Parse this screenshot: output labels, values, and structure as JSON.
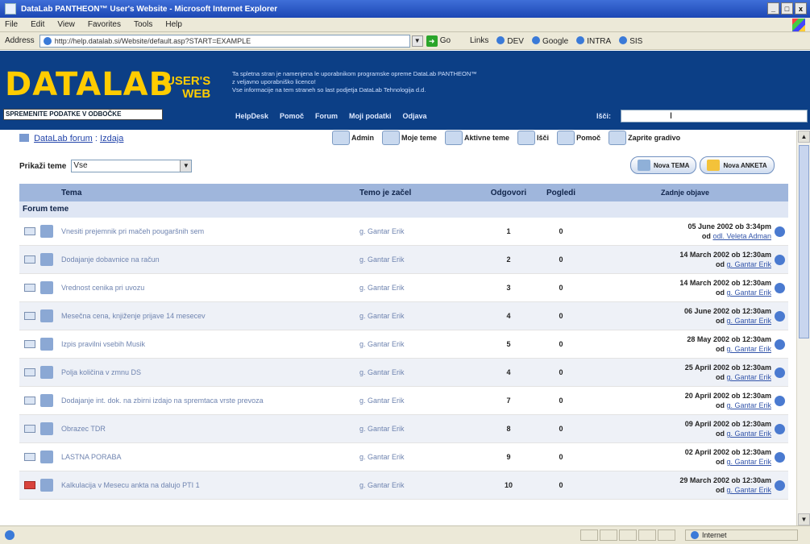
{
  "window": {
    "title": "DataLab PANTHEON™ User's Website - Microsoft Internet Explorer",
    "min": "_",
    "max": "□",
    "close": "x"
  },
  "menu": [
    "File",
    "Edit",
    "View",
    "Favorites",
    "Tools",
    "Help"
  ],
  "address": {
    "label": "Address",
    "url": "http://help.datalab.si/Website/default.asp?START=EXAMPLE",
    "go": "Go",
    "links_label": "Links",
    "links": [
      "DEV",
      "Google",
      "INTRA",
      "SIS"
    ]
  },
  "site": {
    "logo": "DATALAB",
    "user": "USER'S",
    "web": "WEB",
    "slogan": "SPREMENITE PODATKE V ODBOČKE",
    "notice": [
      "Ta spletna stran je namenjena le uporabnikom programske opreme DataLab PANTHEON™",
      "z veljavno uporabniško licenco!",
      "Vse informacije na tem straneh so last podjetja DataLab Tehnologija d.d."
    ],
    "nav": [
      "HelpDesk",
      "Pomoč",
      "Forum",
      "Moji podatki",
      "Odjava"
    ],
    "search_label": "Išči:"
  },
  "forum": {
    "breadcrumb_root": "DataLab forum",
    "breadcrumb_sep": ":",
    "breadcrumb_current": "Izdaja",
    "toolbar": [
      "Admin",
      "Moje teme",
      "Aktivne teme",
      "Išči",
      "Pomoč",
      "Zaprite gradivo"
    ],
    "filter_label": "Prikaži teme",
    "filter_value": "Vse",
    "new_topic": "Nova TEMA",
    "new_poll": "Nova ANKETA",
    "columns": {
      "topic": "Tema",
      "author": "Temo je začel",
      "replies": "Odgovori",
      "views": "Pogledi",
      "last": "Zadnje objave"
    },
    "section": "Forum teme",
    "rows": [
      {
        "topic": "Vnesiti prejemnik pri mačeh pougaršnih sem",
        "author": "g. Gantar Erik",
        "replies": "1",
        "views": "0",
        "date": "05 June 2002 ob 3:34pm",
        "by_prefix": "od",
        "by": "odl. Veleta Adman"
      },
      {
        "topic": "Dodajanje dobavnice na račun",
        "author": "g. Gantar Erik",
        "replies": "2",
        "views": "0",
        "date": "14 March 2002 ob 12:30am",
        "by_prefix": "od",
        "by": "g. Gantar Erik"
      },
      {
        "topic": "Vrednost cenika pri uvozu",
        "author": "g. Gantar Erik",
        "replies": "3",
        "views": "0",
        "date": "14 March 2002 ob 12:30am",
        "by_prefix": "od",
        "by": "g. Gantar Erik"
      },
      {
        "topic": "Mesečna cena, knjiženje prijave 14 mesecev",
        "author": "g. Gantar Erik",
        "replies": "4",
        "views": "0",
        "date": "06 June 2002 ob 12:30am",
        "by_prefix": "od",
        "by": "g. Gantar Erik"
      },
      {
        "topic": "Izpis pravilni vsebih Musik",
        "author": "g. Gantar Erik",
        "replies": "5",
        "views": "0",
        "date": "28 May 2002 ob 12:30am",
        "by_prefix": "od",
        "by": "g. Gantar Erik"
      },
      {
        "topic": "Polja količina v zmnu DS",
        "author": "g. Gantar Erik",
        "replies": "4",
        "views": "0",
        "date": "25 April 2002 ob 12:30am",
        "by_prefix": "od",
        "by": "g. Gantar Erik"
      },
      {
        "topic": "Dodajanje int. dok. na zbirni izdajo na spremtaca vrste prevoza",
        "author": "g. Gantar Erik",
        "replies": "7",
        "views": "0",
        "date": "20 April 2002 ob 12:30am",
        "by_prefix": "od",
        "by": "g. Gantar Erik"
      },
      {
        "topic": "Obrazec TDR",
        "author": "g. Gantar Erik",
        "replies": "8",
        "views": "0",
        "date": "09 April 2002 ob 12:30am",
        "by_prefix": "od",
        "by": "g. Gantar Erik"
      },
      {
        "topic": "LASTNA PORABA",
        "author": "g. Gantar Erik",
        "replies": "9",
        "views": "0",
        "date": "02 April 2002 ob 12:30am",
        "by_prefix": "od",
        "by": "g. Gantar Erik"
      },
      {
        "topic": "Kalkulacija v Mesecu ankta na dalujo PTI 1",
        "author": "g. Gantar Erik",
        "replies": "10",
        "views": "0",
        "date": "29 March 2002 ob 12:30am",
        "by_prefix": "od",
        "by": "g. Gantar Erik"
      }
    ]
  },
  "status": {
    "zone": "Internet"
  }
}
